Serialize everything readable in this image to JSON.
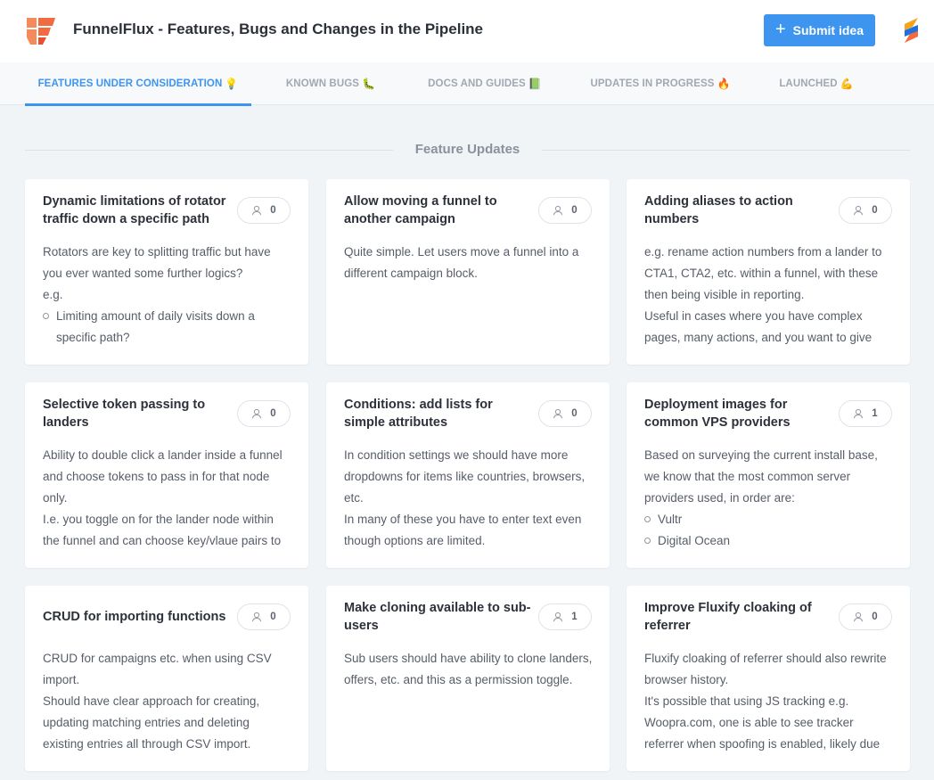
{
  "header": {
    "title": "FunnelFlux - Features, Bugs and Changes in the Pipeline",
    "submit_label": "Submit idea",
    "logo_icon": "funnelflux-logo-icon",
    "brand_icon": "sleekplan-s-icon",
    "accent": "#3d95f0"
  },
  "tabs": [
    {
      "label": "FEATURES UNDER CONSIDERATION",
      "emoji": "💡",
      "active": true
    },
    {
      "label": "KNOWN BUGS",
      "emoji": "🐛",
      "active": false
    },
    {
      "label": "DOCS AND GUIDES",
      "emoji": "📗",
      "active": false
    },
    {
      "label": "UPDATES IN PROGRESS",
      "emoji": "🔥",
      "active": false
    },
    {
      "label": "LAUNCHED",
      "emoji": "💪",
      "active": false
    }
  ],
  "section": {
    "title": "Feature Updates"
  },
  "cards": [
    {
      "title": "Dynamic limitations of rotator traffic down a specific path",
      "votes": "0",
      "paragraphs": [
        "Rotators are key to splitting traffic but have you ever wanted some further logics?",
        "e.g."
      ],
      "bullets": [
        "Limiting amount of daily visits down a specific path?"
      ],
      "after": []
    },
    {
      "title": "Allow moving a funnel to another campaign",
      "votes": "0",
      "paragraphs": [
        "Quite simple. Let users move a funnel into a different campaign block."
      ],
      "bullets": [],
      "after": []
    },
    {
      "title": "Adding aliases to action numbers",
      "votes": "0",
      "paragraphs": [
        "e.g. rename action numbers from a lander to CTA1, CTA2, etc. within a funnel, with these then being visible in reporting.",
        "Useful in cases where you have complex pages, many actions, and you want to give"
      ],
      "bullets": [],
      "after": []
    },
    {
      "title": "Selective token passing to landers",
      "votes": "0",
      "paragraphs": [
        "Ability to double click a lander inside a funnel and choose tokens to pass in for that node only.",
        "I.e. you toggle on for the lander node within the funnel and can choose key/vlaue pairs to"
      ],
      "bullets": [],
      "after": []
    },
    {
      "title": "Conditions: add lists for simple attributes",
      "votes": "0",
      "paragraphs": [
        "In condition settings we should have more dropdowns for items like countries, browsers, etc.",
        "In many of these you have to enter text even though options are limited."
      ],
      "bullets": [],
      "after": []
    },
    {
      "title": "Deployment images for common VPS providers",
      "votes": "1",
      "paragraphs": [
        "Based on surveying the current install base, we know that the most common server providers used, in order are:"
      ],
      "bullets": [
        "Vultr",
        "Digital Ocean"
      ],
      "after": []
    },
    {
      "title": "CRUD for importing functions",
      "votes": "0",
      "paragraphs": [
        "CRUD for campaigns etc. when using CSV import.",
        "Should have clear approach for creating, updating matching entries and deleting existing entries all through CSV import."
      ],
      "bullets": [],
      "after": []
    },
    {
      "title": "Make cloning available to sub-users",
      "votes": "1",
      "paragraphs": [
        "Sub users should have ability to clone landers, offers, etc. and this as a permission toggle."
      ],
      "bullets": [],
      "after": []
    },
    {
      "title": "Improve Fluxify cloaking of referrer",
      "votes": "0",
      "paragraphs": [
        "Fluxify cloaking of referrer should also rewrite browser history.",
        "It's possible that using JS tracking e.g. Woopra.com, one is able to see tracker referrer when spoofing is enabled, likely due"
      ],
      "bullets": [],
      "after": []
    }
  ]
}
